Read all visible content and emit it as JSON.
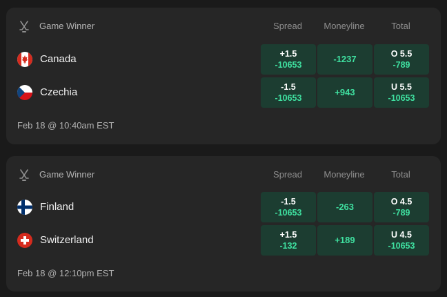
{
  "colors": {
    "background": "#1a1a1a",
    "card": "#262626",
    "odds_button": "#1c3d31",
    "odds_text": "#3fe0a0"
  },
  "games": [
    {
      "market": "Game Winner",
      "market_icon": "hockey-sticks-icon",
      "columns": {
        "spread": "Spread",
        "moneyline": "Moneyline",
        "total": "Total"
      },
      "teams": [
        {
          "name": "Canada",
          "flag": "canada-flag-icon",
          "spread": {
            "line": "+1.5",
            "odds": "-10653"
          },
          "moneyline": "-1237",
          "total": {
            "line": "O 5.5",
            "odds": "-789"
          }
        },
        {
          "name": "Czechia",
          "flag": "czechia-flag-icon",
          "spread": {
            "line": "-1.5",
            "odds": "-10653"
          },
          "moneyline": "+943",
          "total": {
            "line": "U 5.5",
            "odds": "-10653"
          }
        }
      ],
      "start_time": "Feb 18 @ 10:40am EST"
    },
    {
      "market": "Game Winner",
      "market_icon": "hockey-sticks-icon",
      "columns": {
        "spread": "Spread",
        "moneyline": "Moneyline",
        "total": "Total"
      },
      "teams": [
        {
          "name": "Finland",
          "flag": "finland-flag-icon",
          "spread": {
            "line": "-1.5",
            "odds": "-10653"
          },
          "moneyline": "-263",
          "total": {
            "line": "O 4.5",
            "odds": "-789"
          }
        },
        {
          "name": "Switzerland",
          "flag": "switzerland-flag-icon",
          "spread": {
            "line": "+1.5",
            "odds": "-132"
          },
          "moneyline": "+189",
          "total": {
            "line": "U 4.5",
            "odds": "-10653"
          }
        }
      ],
      "start_time": "Feb 18 @ 12:10pm EST"
    }
  ]
}
